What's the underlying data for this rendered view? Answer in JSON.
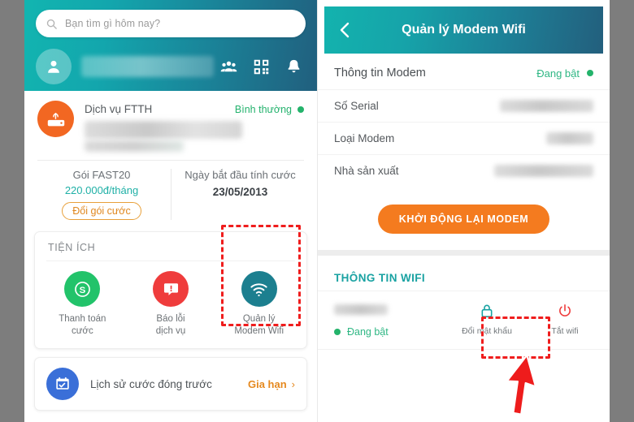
{
  "left_panel": {
    "search": {
      "placeholder": "Bạn tìm gì hôm nay?",
      "icon": "search-icon"
    },
    "header_icons": [
      {
        "name": "friends-icon",
        "label": "Bạn bè"
      },
      {
        "name": "qr-code-icon",
        "label": "QR"
      },
      {
        "name": "bell-icon",
        "label": "Thông báo"
      }
    ],
    "service": {
      "icon": "router-icon",
      "title": "Dịch vụ FTTH",
      "status": "Bình thường",
      "status_color": "#24b36b",
      "subtitle_redacted": true
    },
    "plan": {
      "name": "Gói FAST20",
      "price": "220.000đ/tháng",
      "change_button": "Đổi gói cước",
      "billing_label": "Ngày bắt đầu tính cước",
      "billing_date": "23/05/2013"
    },
    "utilities": {
      "title": "TIỆN ÍCH",
      "tiles": [
        {
          "icon": "money-icon",
          "color": "#22c36a",
          "line1": "Thanh toán",
          "line2": "cước"
        },
        {
          "icon": "report-error-icon",
          "color": "#ef3c3c",
          "line1": "Báo lỗi",
          "line2": "dịch vụ"
        },
        {
          "icon": "wifi-icon",
          "color": "#1c7f8f",
          "line1": "Quản lý",
          "line2": "Modem Wifi"
        }
      ]
    },
    "history": {
      "icon": "calendar-check-icon",
      "label": "Lịch sử cước đóng trước",
      "action": "Gia hạn",
      "chevron": "›"
    }
  },
  "right_panel": {
    "header": {
      "back_icon": "back-arrow-icon",
      "title": "Quản lý Modem Wifi"
    },
    "modem_section": {
      "title": "Thông tin Modem",
      "status": "Đang bật",
      "status_color": "#2fb784",
      "rows": [
        {
          "label": "Số Serial",
          "value_redacted": true
        },
        {
          "label": "Loại Modem",
          "value_redacted": true
        },
        {
          "label": "Nhà sản xuất",
          "value_redacted": true
        }
      ],
      "restart_button": "KHỞI ĐỘNG LẠI MODEM",
      "restart_button_color": "#f47b1f"
    },
    "wifi_section": {
      "title": "THÔNG TIN WIFI",
      "ssid_redacted": true,
      "state": "Đang bật",
      "state_color": "#2fb784",
      "actions": [
        {
          "icon": "lock-icon",
          "label": "Đổi mật khẩu",
          "color": "#19a2a2",
          "highlighted": true
        },
        {
          "icon": "power-icon",
          "label": "Tắt wifi",
          "color": "#ef3c3c",
          "highlighted": false
        }
      ]
    }
  },
  "annotations": {
    "highlight_color": "#ef1d1d",
    "boxes": [
      {
        "name": "highlight-wifi-tile",
        "target": "Quản lý Modem Wifi"
      },
      {
        "name": "highlight-change-password",
        "target": "Đổi mật khẩu"
      }
    ],
    "arrow": {
      "name": "pointer-arrow",
      "points_to": "Đổi mật khẩu"
    }
  }
}
